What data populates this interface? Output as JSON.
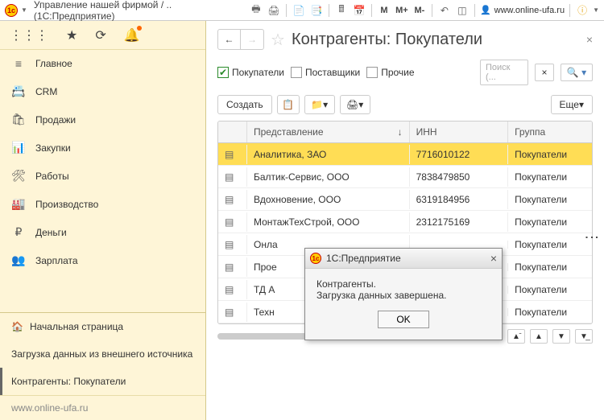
{
  "app": {
    "title": "Управление нашей фирмой / .. (1С:Предприятие)",
    "user_link": "www.online-ufa.ru",
    "site": "www.online-ufa.ru"
  },
  "memory": {
    "m": "M",
    "mp": "M+",
    "mm": "M-"
  },
  "menu": [
    {
      "icon": "≡",
      "label": "Главное"
    },
    {
      "icon": "📇",
      "label": "CRM"
    },
    {
      "icon": "🛍",
      "label": "Продажи"
    },
    {
      "icon": "📊",
      "label": "Закупки"
    },
    {
      "icon": "🛠",
      "label": "Работы"
    },
    {
      "icon": "🏭",
      "label": "Производство"
    },
    {
      "icon": "₽",
      "label": "Деньги"
    },
    {
      "icon": "👥",
      "label": "Зарплата"
    }
  ],
  "open_pages": {
    "home": "Начальная страница",
    "load": "Загрузка данных из внешнего источника",
    "contr": "Контрагенты: Покупатели"
  },
  "page": {
    "title": "Контрагенты: Покупатели",
    "filters": {
      "buyers": "Покупатели",
      "suppliers": "Поставщики",
      "other": "Прочие"
    },
    "search_placeholder": "Поиск (...",
    "create": "Создать",
    "more": "Еще"
  },
  "table": {
    "cols": {
      "name": "Представление",
      "inn": "ИНН",
      "group": "Группа"
    },
    "rows": [
      {
        "name": "Аналитика, ЗАО",
        "inn": "7716010122",
        "group": "Покупатели",
        "sel": true
      },
      {
        "name": "Балтик-Сервис, ООО",
        "inn": "7838479850",
        "group": "Покупатели"
      },
      {
        "name": "Вдохновение, ООО",
        "inn": "6319184956",
        "group": "Покупатели"
      },
      {
        "name": "МонтажТехСтрой, ООО",
        "inn": "2312175169",
        "group": "Покупатели"
      },
      {
        "name": "Онла",
        "inn": "",
        "group": "Покупатели"
      },
      {
        "name": "Прое",
        "inn": "",
        "group": "Покупатели"
      },
      {
        "name": "ТД А",
        "inn": "",
        "group": "Покупатели"
      },
      {
        "name": "Техн",
        "inn": "",
        "group": "Покупатели"
      }
    ]
  },
  "dialog": {
    "title": "1С:Предприятие",
    "line1": "Контрагенты.",
    "line2": "Загрузка данных завершена.",
    "ok": "OK"
  }
}
